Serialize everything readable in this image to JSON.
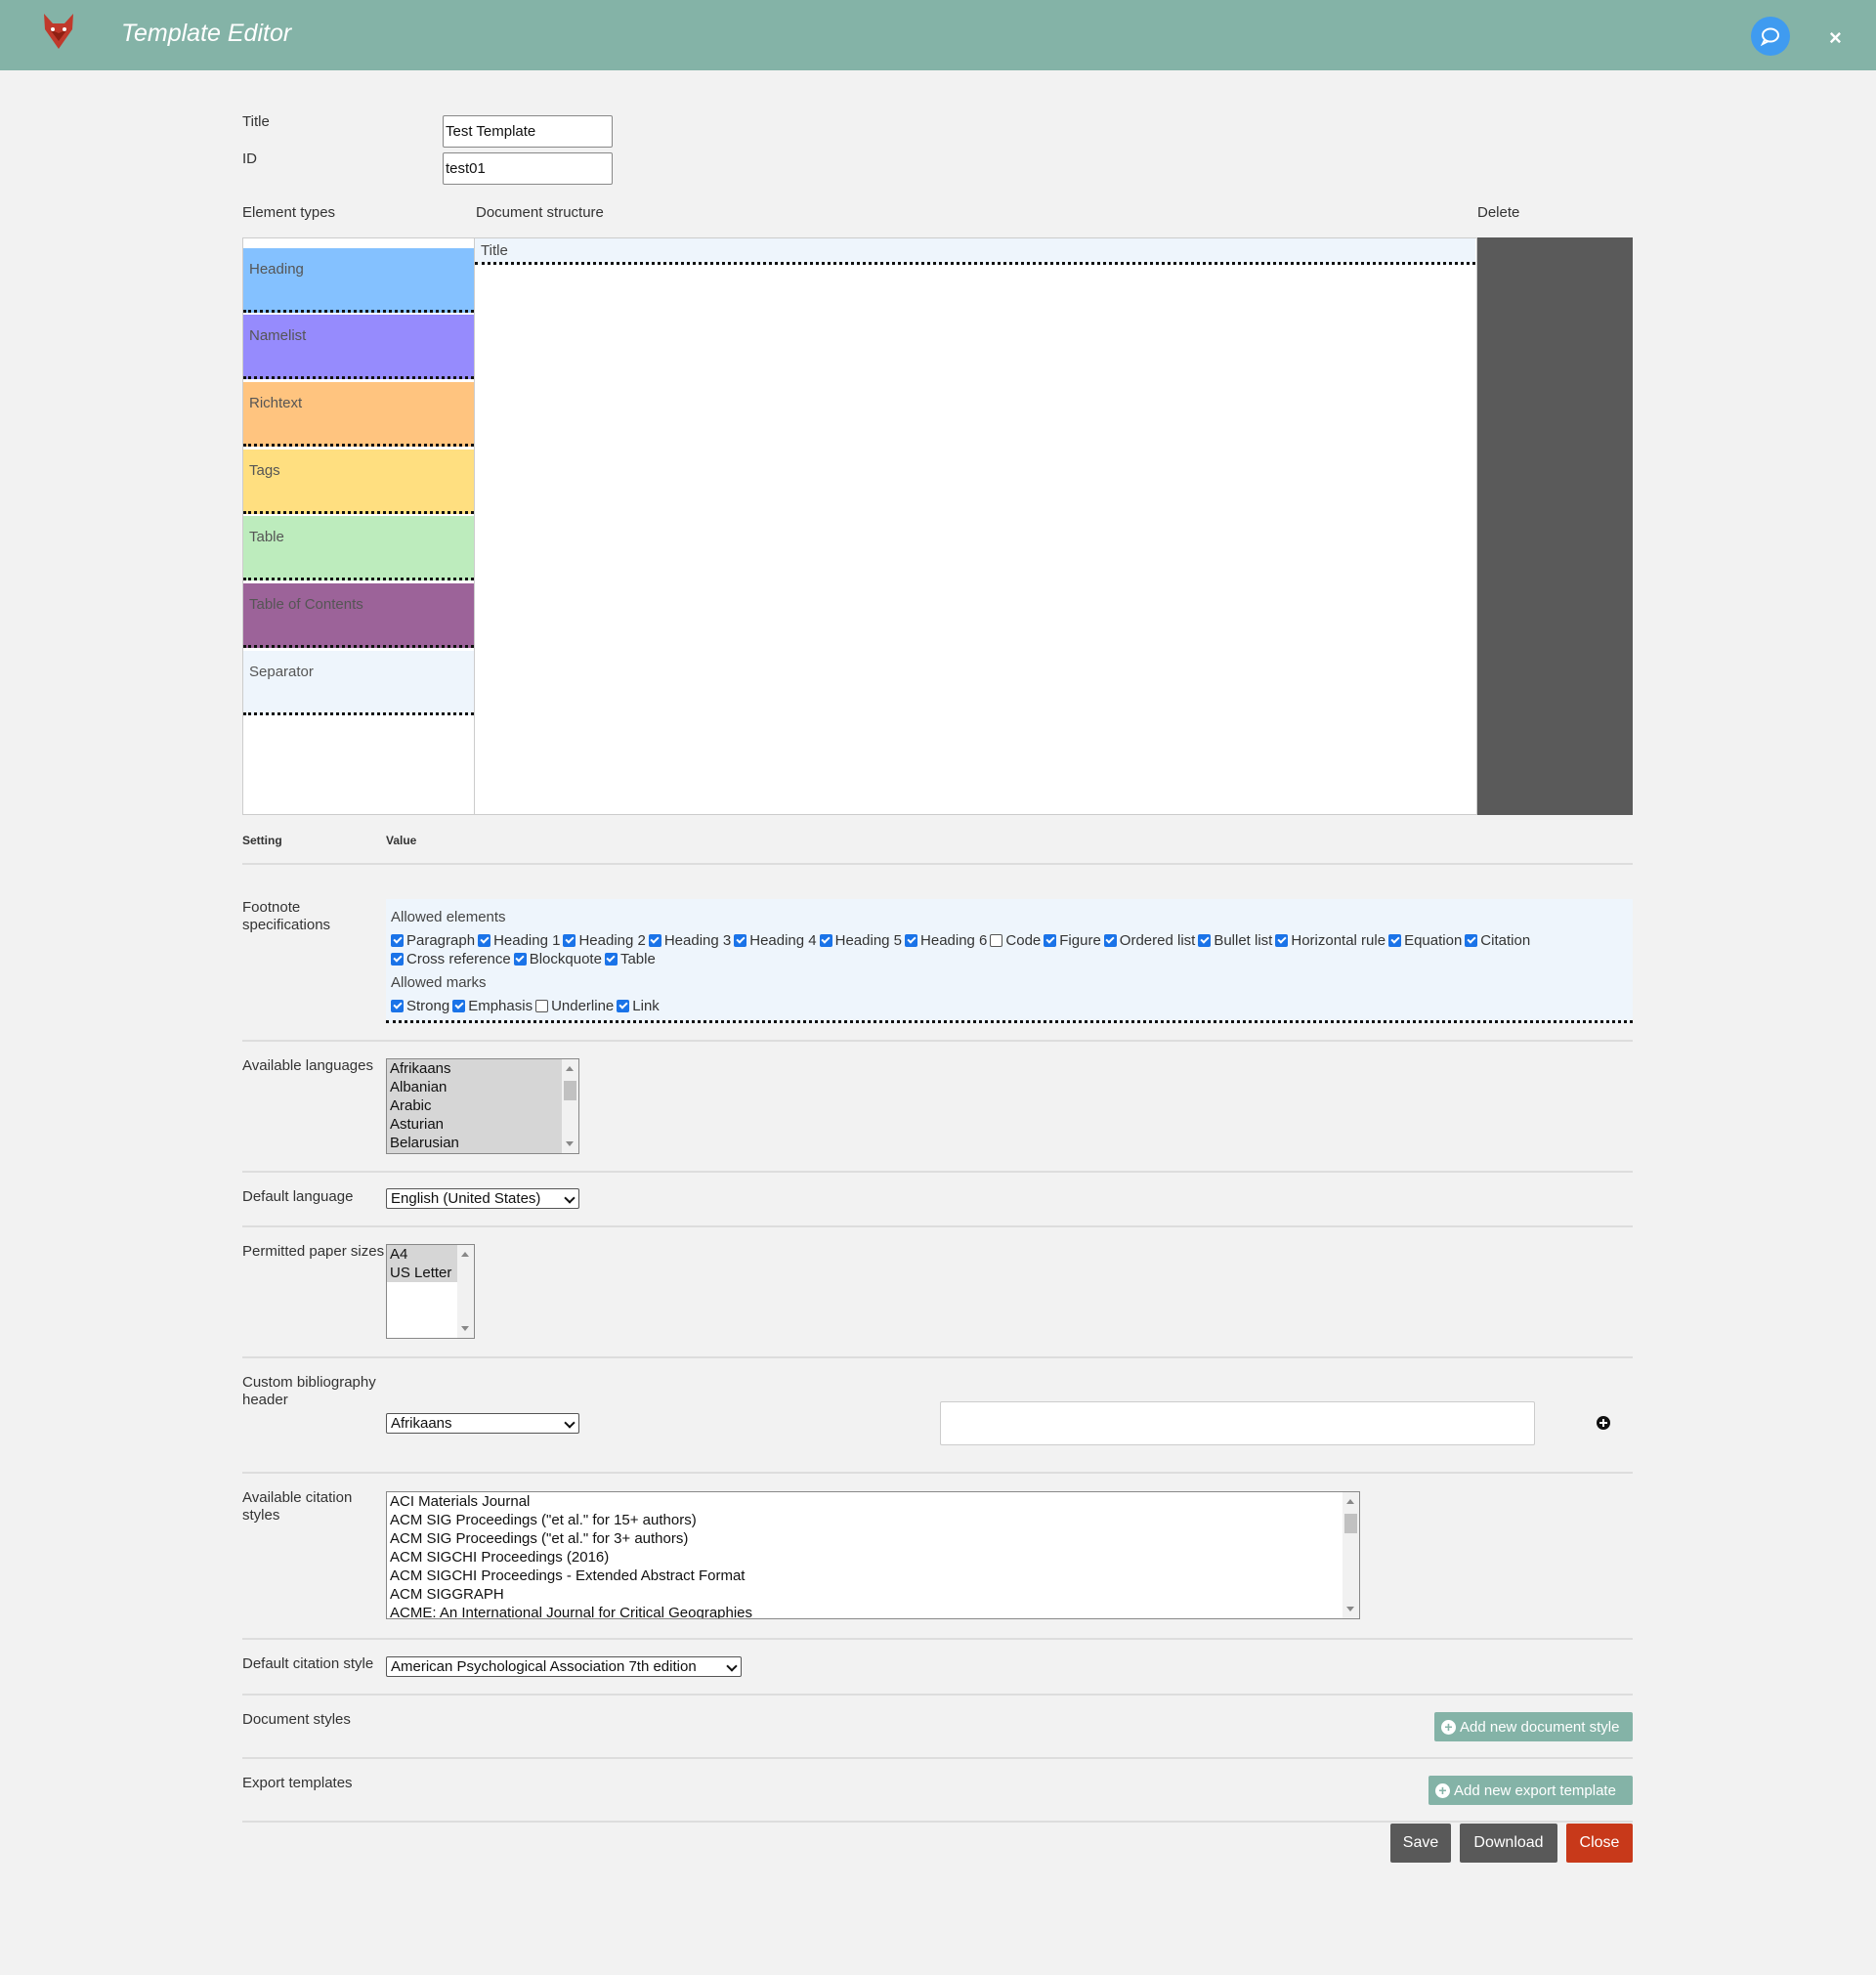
{
  "header": {
    "title": "Template Editor",
    "close_symbol": "×"
  },
  "form": {
    "title_label": "Title",
    "title_value": "Test Template",
    "id_label": "ID",
    "id_value": "test01"
  },
  "editor": {
    "element_types_label": "Element types",
    "document_structure_label": "Document structure",
    "delete_label": "Delete",
    "element_types": [
      {
        "label": "Heading",
        "color": "#84c1ff"
      },
      {
        "label": "Namelist",
        "color": "#968bfd"
      },
      {
        "label": "Richtext",
        "color": "#ffc47f"
      },
      {
        "label": "Tags",
        "color": "#ffdf80"
      },
      {
        "label": "Table",
        "color": "#bdecbd"
      },
      {
        "label": "Table of Contents",
        "color": "#9c6399"
      },
      {
        "label": "Separator",
        "color": "#eef5fc"
      }
    ],
    "structure_items": [
      "Title"
    ]
  },
  "settings": {
    "setting_header": "Setting",
    "value_header": "Value",
    "footnote": {
      "label_line1": "Footnote",
      "label_line2": "specifications",
      "allowed_elements_label": "Allowed elements",
      "elements": [
        {
          "label": "Paragraph",
          "checked": true
        },
        {
          "label": "Heading 1",
          "checked": true
        },
        {
          "label": "Heading 2",
          "checked": true
        },
        {
          "label": "Heading 3",
          "checked": true
        },
        {
          "label": "Heading 4",
          "checked": true
        },
        {
          "label": "Heading 5",
          "checked": true
        },
        {
          "label": "Heading 6",
          "checked": true
        },
        {
          "label": "Code",
          "checked": false
        },
        {
          "label": "Figure",
          "checked": true
        },
        {
          "label": "Ordered list",
          "checked": true
        },
        {
          "label": "Bullet list",
          "checked": true
        },
        {
          "label": "Horizontal rule",
          "checked": true
        },
        {
          "label": "Equation",
          "checked": true
        },
        {
          "label": "Citation",
          "checked": true
        },
        {
          "label": "Cross reference",
          "checked": true
        },
        {
          "label": "Blockquote",
          "checked": true
        },
        {
          "label": "Table",
          "checked": true
        }
      ],
      "allowed_marks_label": "Allowed marks",
      "marks": [
        {
          "label": "Strong",
          "checked": true
        },
        {
          "label": "Emphasis",
          "checked": true
        },
        {
          "label": "Underline",
          "checked": false
        },
        {
          "label": "Link",
          "checked": true
        }
      ]
    },
    "available_languages": {
      "label": "Available languages",
      "options": [
        "Afrikaans",
        "Albanian",
        "Arabic",
        "Asturian",
        "Belarusian"
      ]
    },
    "default_language": {
      "label": "Default language",
      "value": "English (United States)"
    },
    "paper_sizes": {
      "label": "Permitted paper sizes",
      "options": [
        "A4",
        "US Letter"
      ]
    },
    "bibliography_header": {
      "label_line1": "Custom bibliography",
      "label_line2": "header",
      "language_value": "Afrikaans",
      "text_value": ""
    },
    "citation_styles": {
      "label_line1": "Available citation",
      "label_line2": "styles",
      "options": [
        "ACI Materials Journal",
        "ACM SIG Proceedings (\"et al.\" for 15+ authors)",
        "ACM SIG Proceedings (\"et al.\" for 3+ authors)",
        "ACM SIGCHI Proceedings (2016)",
        "ACM SIGCHI Proceedings - Extended Abstract Format",
        "ACM SIGGRAPH",
        "ACME: An International Journal for Critical Geographies"
      ]
    },
    "default_citation_style": {
      "label": "Default citation style",
      "value": "American Psychological Association 7th edition"
    },
    "document_styles": {
      "label": "Document styles",
      "button": "Add new document style"
    },
    "export_templates": {
      "label": "Export templates",
      "button": "Add new export template"
    }
  },
  "actions": {
    "save": "Save",
    "download": "Download",
    "close": "Close"
  },
  "colors": {
    "header": "#84b3a7",
    "chat": "#3f9bf0",
    "delete_zone": "#5a5a5a",
    "close_button": "#c8391a",
    "dark_button": "#595959"
  }
}
